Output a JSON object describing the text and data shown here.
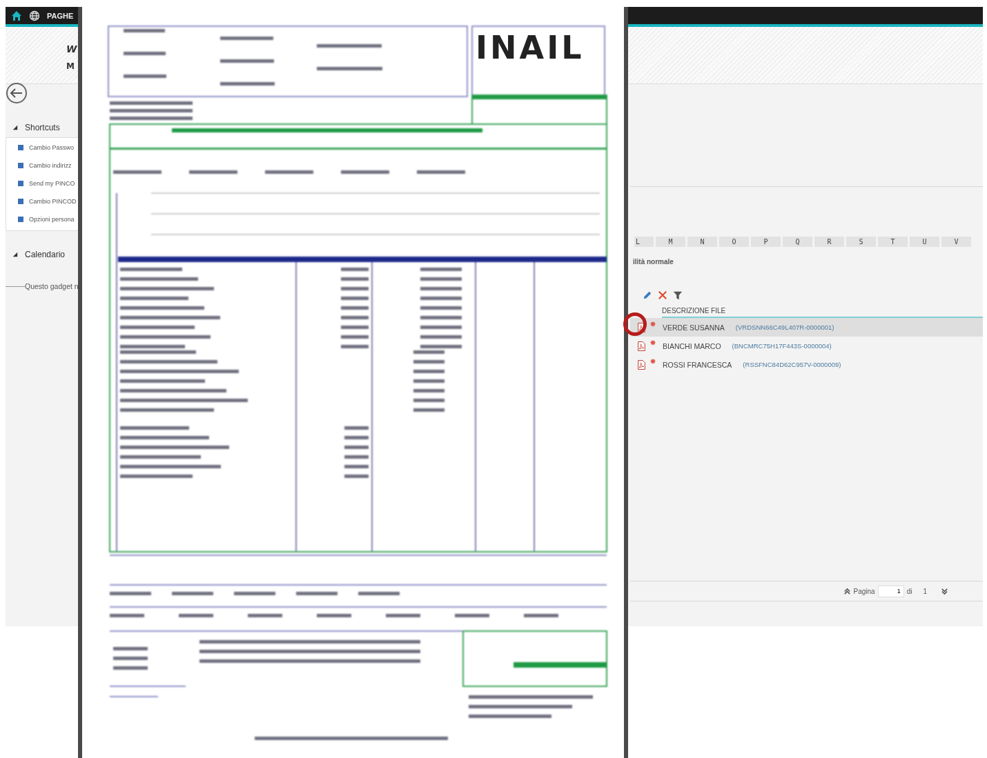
{
  "top_bar": {
    "title": "PAGHE"
  },
  "header": {
    "line_1": "W",
    "line_2": "M"
  },
  "sidebar": {
    "sections": [
      {
        "title": "Shortcuts",
        "expanded": true,
        "items": [
          "Cambio Passwo",
          "Cambio indirizz",
          "Send my PINCO",
          "Cambio PINCOD",
          "Opzioni persona"
        ]
      },
      {
        "title": "Calendario",
        "expanded": true,
        "note": "Questo gadget n"
      }
    ]
  },
  "grid": {
    "columns": [
      "L",
      "M",
      "N",
      "O",
      "P",
      "Q",
      "R",
      "S",
      "T",
      "U",
      "V"
    ]
  },
  "mode_label": "ilità normale",
  "files": {
    "header": "DESCRIZIONE FILE",
    "rows": [
      {
        "name": "VERDE SUSANNA",
        "code": "(VRDSNN66C49L407R-0000001)",
        "selected": true,
        "highlighted": true
      },
      {
        "name": "BIANCHI MARCO",
        "code": "(BNCMRC75H17F443S-0000004)",
        "selected": false,
        "highlighted": false
      },
      {
        "name": "ROSSI FRANCESCA",
        "code": "(RSSFNC84D62C957V-0000009)",
        "selected": false,
        "highlighted": false
      }
    ]
  },
  "pagination": {
    "label": "Pagina",
    "page": "1",
    "of": "di",
    "total": "1"
  },
  "document": {
    "logo": "INAIL"
  }
}
